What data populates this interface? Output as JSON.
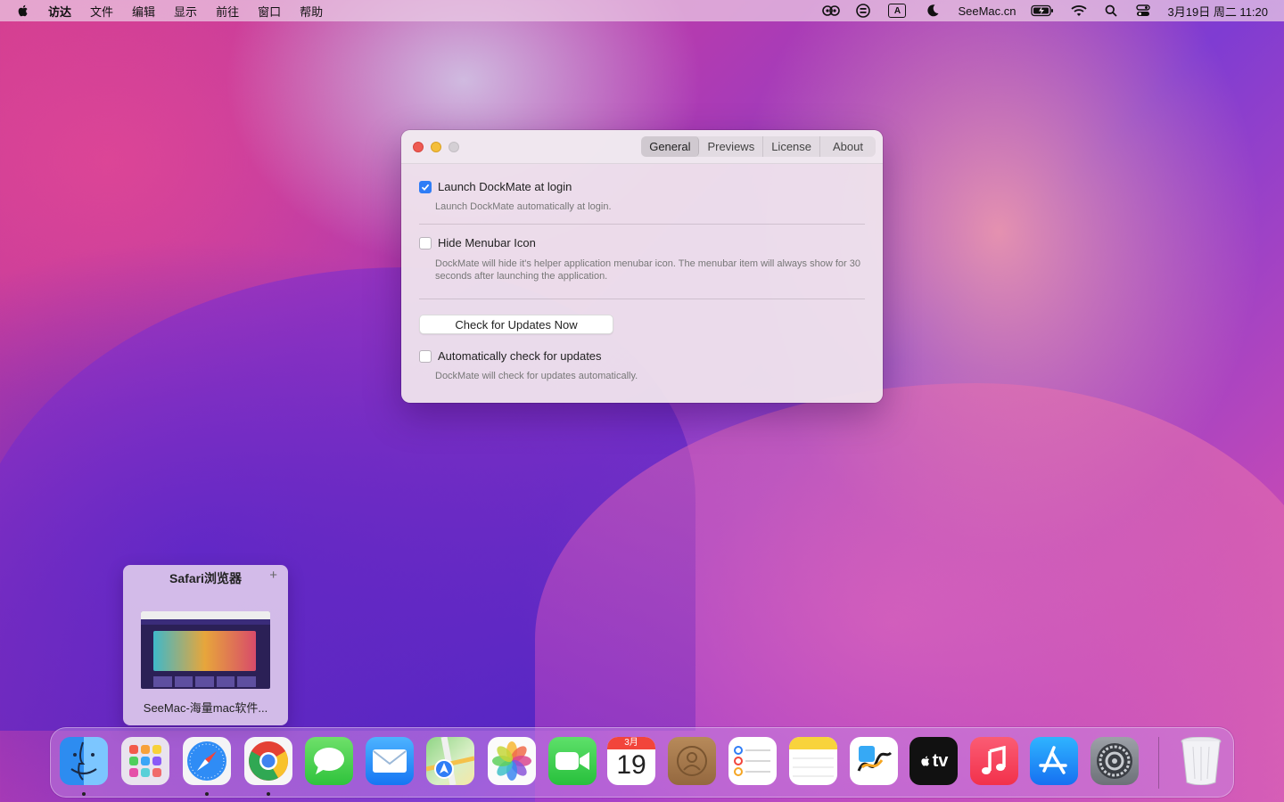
{
  "menubar": {
    "app": "访达",
    "menus": [
      "文件",
      "编辑",
      "显示",
      "前往",
      "窗口",
      "帮助"
    ],
    "status_text": "SeeMac.cn",
    "input_indicator": "A",
    "clock": "3月19日 周二  11:20"
  },
  "window": {
    "tabs": [
      "General",
      "Previews",
      "License",
      "About"
    ],
    "active_tab": "General",
    "options": [
      {
        "label": "Launch DockMate at login",
        "checked": true,
        "desc": "Launch DockMate automatically at login."
      },
      {
        "label": "Hide Menubar Icon",
        "checked": false,
        "desc": "DockMate will hide it's helper application menubar icon. The menubar item will always show for 30 seconds after launching the application."
      },
      {
        "label": "Automatically check for updates",
        "checked": false,
        "desc": "DockMate will check for updates automatically."
      }
    ],
    "update_button": "Check for Updates Now"
  },
  "preview": {
    "title": "Safari浏览器",
    "add": "+",
    "caption": "SeeMac-海量mac软件..."
  },
  "dock": {
    "calendar_month": "3月",
    "calendar_day": "19",
    "tv_label": "tv",
    "apps": [
      "finder",
      "launchpad",
      "safari",
      "chrome",
      "messages",
      "mail",
      "maps",
      "photos",
      "facetime",
      "calendar",
      "contacts",
      "reminders",
      "notes",
      "freeform",
      "tv",
      "music",
      "app-store",
      "system-settings",
      "trash"
    ],
    "running": [
      "finder",
      "safari",
      "chrome"
    ]
  },
  "colors": {
    "accent": "#2f7df6",
    "close": "#ee5a52",
    "minimize": "#f4be3a"
  }
}
